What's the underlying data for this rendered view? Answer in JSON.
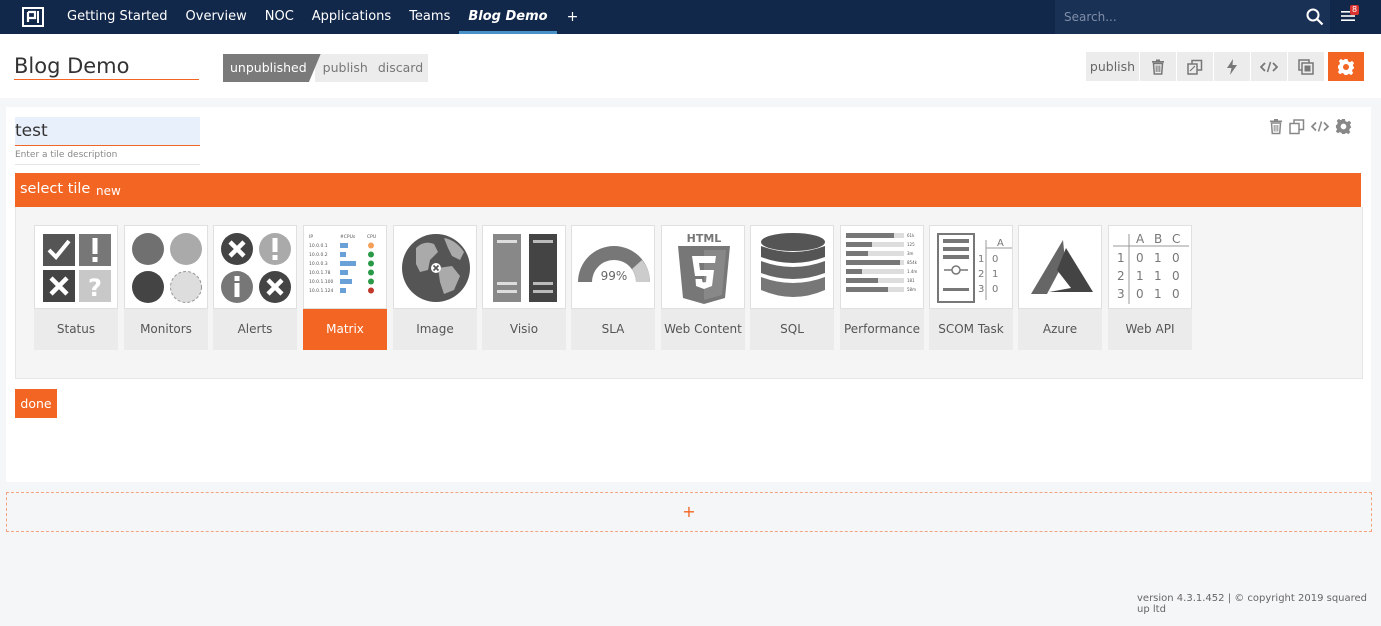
{
  "nav": {
    "items": [
      {
        "label": "Getting Started"
      },
      {
        "label": "Overview"
      },
      {
        "label": "NOC"
      },
      {
        "label": "Applications"
      },
      {
        "label": "Teams"
      },
      {
        "label": "Blog Demo"
      }
    ],
    "add_label": "+",
    "search_placeholder": "Search...",
    "notification_count": "8"
  },
  "header": {
    "title": "Blog Demo",
    "state_label": "unpublished",
    "publish_label": "publish",
    "discard_label": "discard",
    "toolbar_publish_label": "publish"
  },
  "tile": {
    "name": "test",
    "description_placeholder": "Enter a tile description",
    "select_label": "select tile",
    "new_label": "new",
    "done_label": "done"
  },
  "tiles": [
    {
      "label": "Status",
      "icon": "status-icon"
    },
    {
      "label": "Monitors",
      "icon": "monitors-icon"
    },
    {
      "label": "Alerts",
      "icon": "alerts-icon"
    },
    {
      "label": "Matrix",
      "icon": "matrix-icon",
      "selected": true
    },
    {
      "label": "Image",
      "icon": "globe-icon"
    },
    {
      "label": "Visio",
      "icon": "visio-icon"
    },
    {
      "label": "SLA",
      "icon": "sla-gauge-icon",
      "value": "99%"
    },
    {
      "label": "Web Content",
      "icon": "html5-icon",
      "text": "HTML"
    },
    {
      "label": "SQL",
      "icon": "database-icon"
    },
    {
      "label": "Performance",
      "icon": "performance-icon"
    },
    {
      "label": "SCOM Task",
      "icon": "scom-task-icon"
    },
    {
      "label": "Azure",
      "icon": "azure-icon"
    },
    {
      "label": "Web API",
      "icon": "web-api-icon"
    }
  ],
  "add_row_label": "+",
  "footer": "version 4.3.1.452  | © copyright 2019 squared up ltd",
  "colors": {
    "accent": "#f26522",
    "nav": "#12284a"
  }
}
